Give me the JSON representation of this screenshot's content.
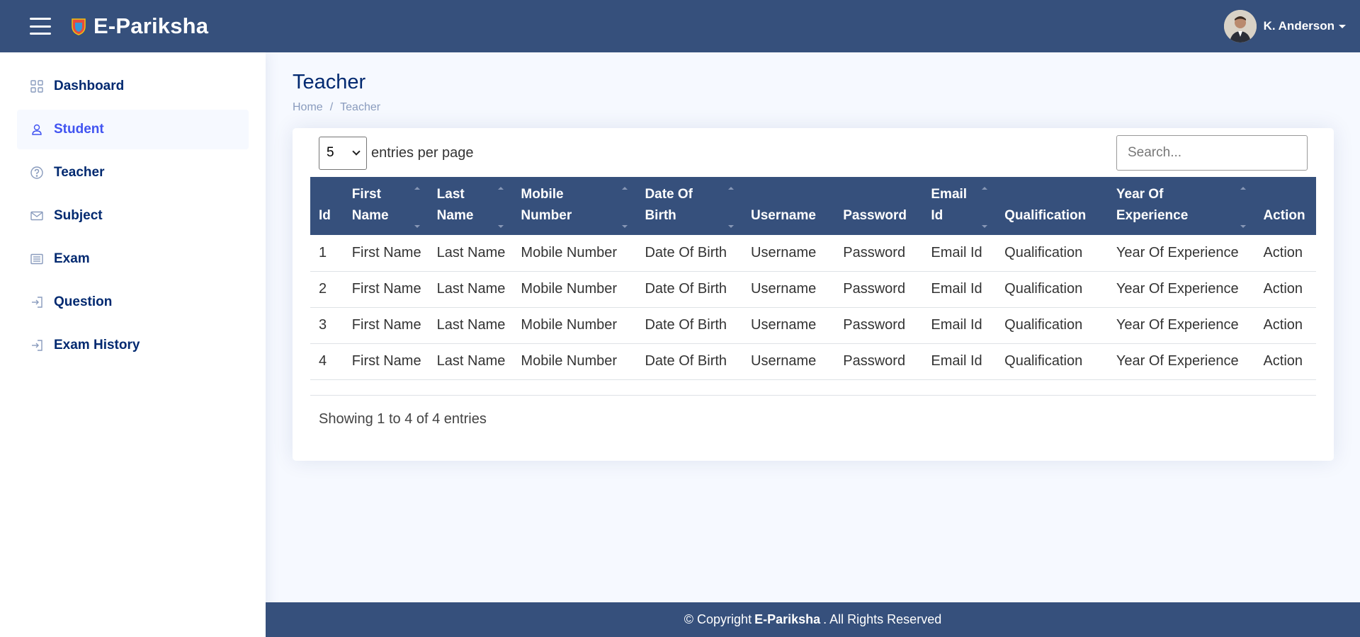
{
  "brand": {
    "name": "E-Pariksha"
  },
  "user": {
    "name": "K. Anderson"
  },
  "sidebar": {
    "items": [
      {
        "label": "Dashboard",
        "icon": "grid-icon",
        "active": false
      },
      {
        "label": "Student",
        "icon": "person-icon",
        "active": true
      },
      {
        "label": "Teacher",
        "icon": "question-circle-icon",
        "active": false
      },
      {
        "label": "Subject",
        "icon": "envelope-icon",
        "active": false
      },
      {
        "label": "Exam",
        "icon": "list-icon",
        "active": false
      },
      {
        "label": "Question",
        "icon": "login-icon",
        "active": false
      },
      {
        "label": "Exam History",
        "icon": "login-icon",
        "active": false
      }
    ]
  },
  "page": {
    "title": "Teacher",
    "breadcrumb": {
      "home": "Home",
      "separator": "/",
      "current": "Teacher"
    }
  },
  "table_controls": {
    "per_page_value": "5",
    "per_page_label": "entries per page",
    "search_placeholder": "Search..."
  },
  "table": {
    "headers": [
      {
        "line1": "Id",
        "line2": ""
      },
      {
        "line1": "First",
        "line2": "Name"
      },
      {
        "line1": "Last",
        "line2": "Name"
      },
      {
        "line1": "Mobile",
        "line2": "Number"
      },
      {
        "line1": "Date Of",
        "line2": "Birth"
      },
      {
        "line1": "Username",
        "line2": ""
      },
      {
        "line1": "Password",
        "line2": ""
      },
      {
        "line1": "Email",
        "line2": "Id"
      },
      {
        "line1": "Qualification",
        "line2": ""
      },
      {
        "line1": "Year Of",
        "line2": "Experience"
      },
      {
        "line1": "Action",
        "line2": ""
      }
    ],
    "rows": [
      [
        "1",
        "First Name",
        "Last Name",
        "Mobile Number",
        "Date Of Birth",
        "Username",
        "Password",
        "Email Id",
        "Qualification",
        "Year Of Experience",
        "Action"
      ],
      [
        "2",
        "First Name",
        "Last Name",
        "Mobile Number",
        "Date Of Birth",
        "Username",
        "Password",
        "Email Id",
        "Qualification",
        "Year Of Experience",
        "Action"
      ],
      [
        "3",
        "First Name",
        "Last Name",
        "Mobile Number",
        "Date Of Birth",
        "Username",
        "Password",
        "Email Id",
        "Qualification",
        "Year Of Experience",
        "Action"
      ],
      [
        "4",
        "First Name",
        "Last Name",
        "Mobile Number",
        "Date Of Birth",
        "Username",
        "Password",
        "Email Id",
        "Qualification",
        "Year Of Experience",
        "Action"
      ]
    ],
    "info": "Showing 1 to 4 of 4 entries"
  },
  "footer": {
    "prefix": "© Copyright",
    "brand": "E-Pariksha",
    "suffix": ". All Rights Reserved"
  },
  "colors": {
    "header": "#36507c",
    "accent": "#4154f1",
    "nav_text": "#012970"
  }
}
